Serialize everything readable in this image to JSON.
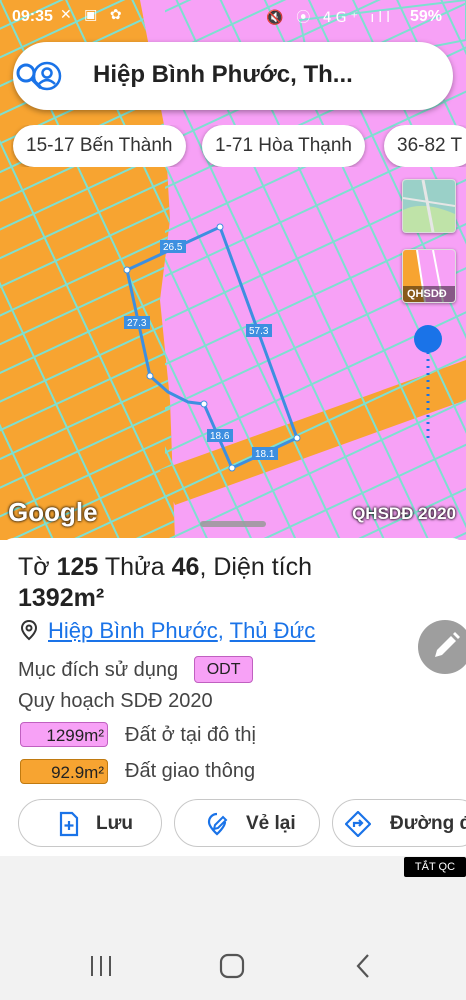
{
  "status_bar": {
    "time": "09:35",
    "left_icons": "✕ ▣ ✿",
    "right_icons": "🔇 ⦿ 4G⁺ ıll",
    "battery": "59%"
  },
  "search": {
    "query": "Hiệp Bình Phước, Th..."
  },
  "chips": [
    "15-17 Bến Thành",
    "1-71 Hòa Thạnh",
    "36-82 T"
  ],
  "map": {
    "layer_qhsdd_label": "QHSDĐ",
    "edge_labels": [
      "26.5",
      "27.3",
      "57.3",
      "18.6",
      "18.1"
    ],
    "watermark": "Google",
    "overlay_name": "QHSDĐ 2020",
    "colors": {
      "residential": "#f7a1f6",
      "transport": "#f7a431",
      "grid_lines": "#7de0d0",
      "parcel_outline": "#3d8fe0"
    }
  },
  "parcel": {
    "sheet_label": "Tờ",
    "sheet_no": "125",
    "parcel_label": "Thửa",
    "parcel_no": "46",
    "area_label": ", Diện tích",
    "area_value": "1392m²",
    "ward": "Hiệp Bình Phước",
    "separator": ", ",
    "district": "Thủ Đức",
    "purpose_label": "Mục đích sử dụng",
    "purpose_code": "ODT",
    "plan_label": "Quy hoạch SDĐ 2020",
    "plan_items": [
      {
        "area": "1299m²",
        "label": "Đất ở tại đô thị",
        "color": "#f7a1f6"
      },
      {
        "area": "92.9m²",
        "label": "Đất giao thông",
        "color": "#f7a431"
      }
    ]
  },
  "actions": {
    "save": "Lưu",
    "redraw": "Vẻ lại",
    "directions": "Đường đi"
  },
  "ad_badge": "TẮT QC"
}
